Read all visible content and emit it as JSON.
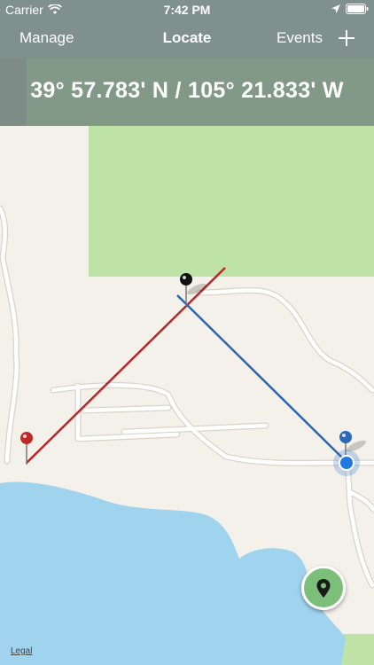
{
  "status_bar": {
    "carrier": "Carrier",
    "time": "7:42 PM",
    "icons": [
      "wifi-icon",
      "location-arrow-icon",
      "battery-icon"
    ]
  },
  "nav": {
    "left_label": "Manage",
    "title": "Locate",
    "right_label": "Events",
    "add_icon": "plus-icon"
  },
  "coordinates": {
    "text": "39° 57.783' N / 105° 21.833' W"
  },
  "map": {
    "legal_label": "Legal",
    "pins": [
      {
        "name": "black-pin",
        "color": "#111111"
      },
      {
        "name": "red-pin",
        "color": "#c0282a"
      },
      {
        "name": "blue-pin",
        "color": "#2a6ab8"
      }
    ],
    "lines": [
      {
        "name": "red-bearing-line",
        "color": "#b8262a"
      },
      {
        "name": "blue-bearing-line",
        "color": "#2e64b0"
      }
    ],
    "colors": {
      "land": "#f4f1ea",
      "park": "#bfe3a6",
      "water": "#9fd3ee",
      "road": "#ffffff"
    }
  },
  "locate_button": {
    "icon": "map-pin-icon",
    "color": "#7cbf7a"
  }
}
